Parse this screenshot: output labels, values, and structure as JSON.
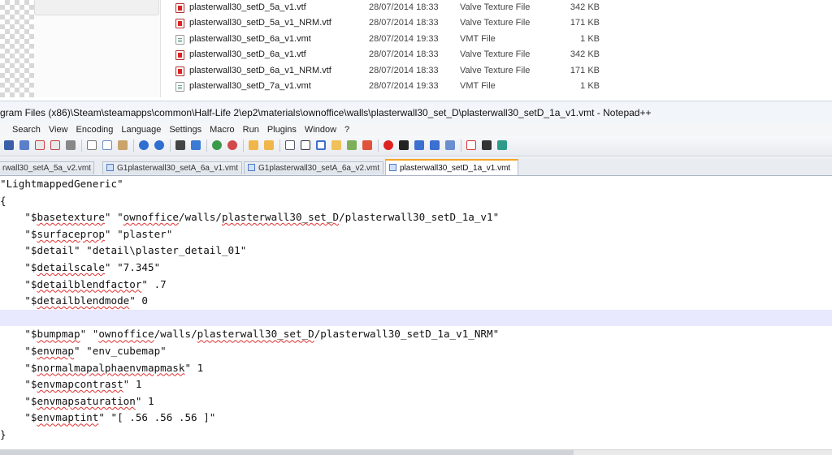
{
  "explorer": {
    "files": [
      {
        "name": "plasterwall30_setD_5a_v1.vtf",
        "date": "28/07/2014 18:33",
        "type": "Valve Texture File",
        "size": "342 KB",
        "icon": "vtf-file-icon",
        "kind": "vtf"
      },
      {
        "name": "plasterwall30_setD_5a_v1_NRM.vtf",
        "date": "28/07/2014 18:33",
        "type": "Valve Texture File",
        "size": "171 KB",
        "icon": "vtf-file-icon",
        "kind": "vtf"
      },
      {
        "name": "plasterwall30_setD_6a_v1.vmt",
        "date": "28/07/2014 19:33",
        "type": "VMT File",
        "size": "1 KB",
        "icon": "vmt-file-icon",
        "kind": "vmt"
      },
      {
        "name": "plasterwall30_setD_6a_v1.vtf",
        "date": "28/07/2014 18:33",
        "type": "Valve Texture File",
        "size": "342 KB",
        "icon": "vtf-file-icon",
        "kind": "vtf"
      },
      {
        "name": "plasterwall30_setD_6a_v1_NRM.vtf",
        "date": "28/07/2014 18:33",
        "type": "Valve Texture File",
        "size": "171 KB",
        "icon": "vtf-file-icon",
        "kind": "vtf"
      },
      {
        "name": "plasterwall30_setD_7a_v1.vmt",
        "date": "28/07/2014 19:33",
        "type": "VMT File",
        "size": "1 KB",
        "icon": "vmt-file-icon",
        "kind": "vmt"
      }
    ]
  },
  "notepad": {
    "title": "gram Files (x86)\\Steam\\steamapps\\common\\Half-Life 2\\ep2\\materials\\ownoffice\\walls\\plasterwall30_set_D\\plasterwall30_setD_1a_v1.vmt - Notepad++",
    "menu": [
      "Search",
      "View",
      "Encoding",
      "Language",
      "Settings",
      "Macro",
      "Run",
      "Plugins",
      "Window",
      "?"
    ],
    "toolbar_icons": [
      "save-icon",
      "save-all-icon",
      "close-icon",
      "close-all-icon",
      "print-icon",
      "cut-icon",
      "copy-icon",
      "paste-icon",
      "undo-icon",
      "redo-icon",
      "find-icon",
      "replace-icon",
      "zoom-in-icon",
      "zoom-out-icon",
      "sync-vertical-icon",
      "sync-horizontal-icon",
      "word-wrap-icon",
      "show-all-chars-icon",
      "indent-guide-icon",
      "doc-map-icon",
      "function-list-icon",
      "folder-workspace-icon",
      "record-macro-icon",
      "stop-record-icon",
      "play-macro-icon",
      "run-macro-multiple-icon",
      "save-macro-icon",
      "spell-check-icon",
      "spell-next-icon",
      "spell-options-icon"
    ],
    "tabs": [
      {
        "label": "rwall30_setA_5a_v2.vmt",
        "active": false
      },
      {
        "label": "G1plasterwall30_setA_6a_v1.vmt",
        "active": false
      },
      {
        "label": "G1plasterwall30_setA_6a_v2.vmt",
        "active": false
      },
      {
        "label": "plasterwall30_setD_1a_v1.vmt",
        "active": true
      }
    ],
    "lines": [
      "\"LightmappedGeneric\"",
      "{",
      "    \"$basetexture\" \"ownoffice/walls/plasterwall30_set_D/plasterwall30_setD_1a_v1\"",
      "    \"$surfaceprop\" \"plaster\"",
      "    \"$detail\" \"detail\\plaster_detail_01\"",
      "    \"$detailscale\" \"7.345\"",
      "    \"$detailblendfactor\" .7",
      "    \"$detailblendmode\" 0",
      "",
      "    \"$bumpmap\" \"ownoffice/walls/plasterwall30_set_D/plasterwall30_setD_1a_v1_NRM\"",
      "    \"$envmap\" \"env_cubemap\"",
      "    \"$normalmapalphaenvmapmask\" 1",
      "    \"$envmapcontrast\" 1",
      "    \"$envmapsaturation\" 1",
      "    \"$envmaptint\" \"[ .56 .56 .56 ]\"",
      "}"
    ],
    "current_line": 9,
    "colors": {
      "current_line_bg": "#e8e8ff",
      "active_tab_accent": "#f5a623",
      "squiggle": "#e03030"
    }
  }
}
